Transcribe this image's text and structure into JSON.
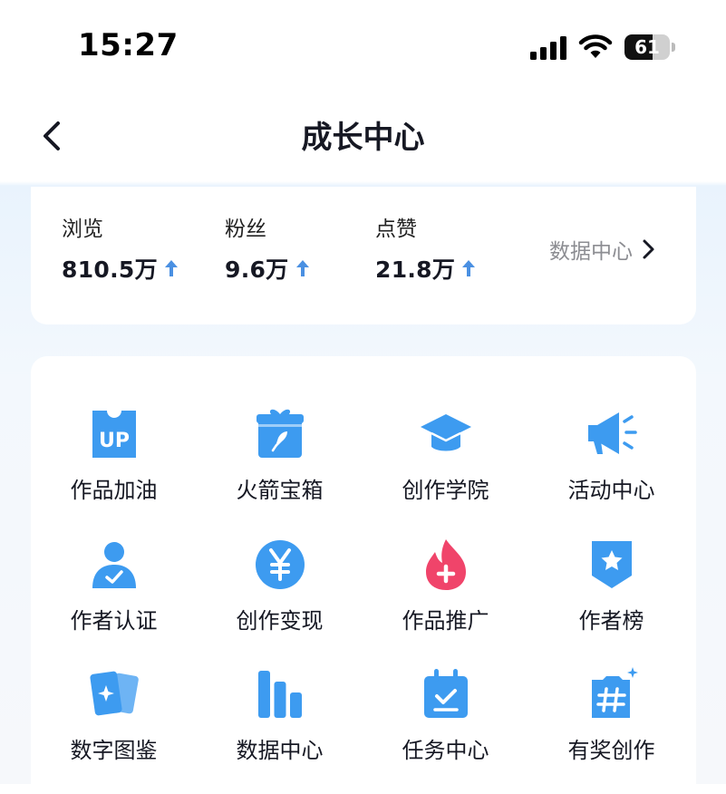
{
  "status_bar": {
    "time": "15:27",
    "battery_level": "61",
    "battery_fraction": 0.61
  },
  "nav": {
    "title": "成长中心",
    "back_icon": "chevron-left-icon"
  },
  "stats": {
    "items": [
      {
        "label": "浏览",
        "value": "810.5万",
        "trend": "up"
      },
      {
        "label": "粉丝",
        "value": "9.6万",
        "trend": "up"
      },
      {
        "label": "点赞",
        "value": "21.8万",
        "trend": "up"
      }
    ],
    "data_center_label": "数据中心"
  },
  "tools": [
    {
      "label": "作品加油",
      "icon": "up-ticket-icon"
    },
    {
      "label": "火箭宝箱",
      "icon": "rocket-box-icon"
    },
    {
      "label": "创作学院",
      "icon": "graduation-cap-icon"
    },
    {
      "label": "活动中心",
      "icon": "megaphone-icon"
    },
    {
      "label": "作者认证",
      "icon": "user-check-icon"
    },
    {
      "label": "创作变现",
      "icon": "yen-coin-icon"
    },
    {
      "label": "作品推广",
      "icon": "flame-plus-icon"
    },
    {
      "label": "作者榜",
      "icon": "star-badge-icon"
    },
    {
      "label": "数字图鉴",
      "icon": "cards-icon"
    },
    {
      "label": "数据中心",
      "icon": "bar-chart-icon"
    },
    {
      "label": "任务中心",
      "icon": "task-calendar-icon"
    },
    {
      "label": "有奖创作",
      "icon": "hashtag-reward-icon"
    }
  ],
  "colors": {
    "accent": "#3d9bf0",
    "flame": "#f0446a",
    "arrow": "#4a90e2"
  }
}
